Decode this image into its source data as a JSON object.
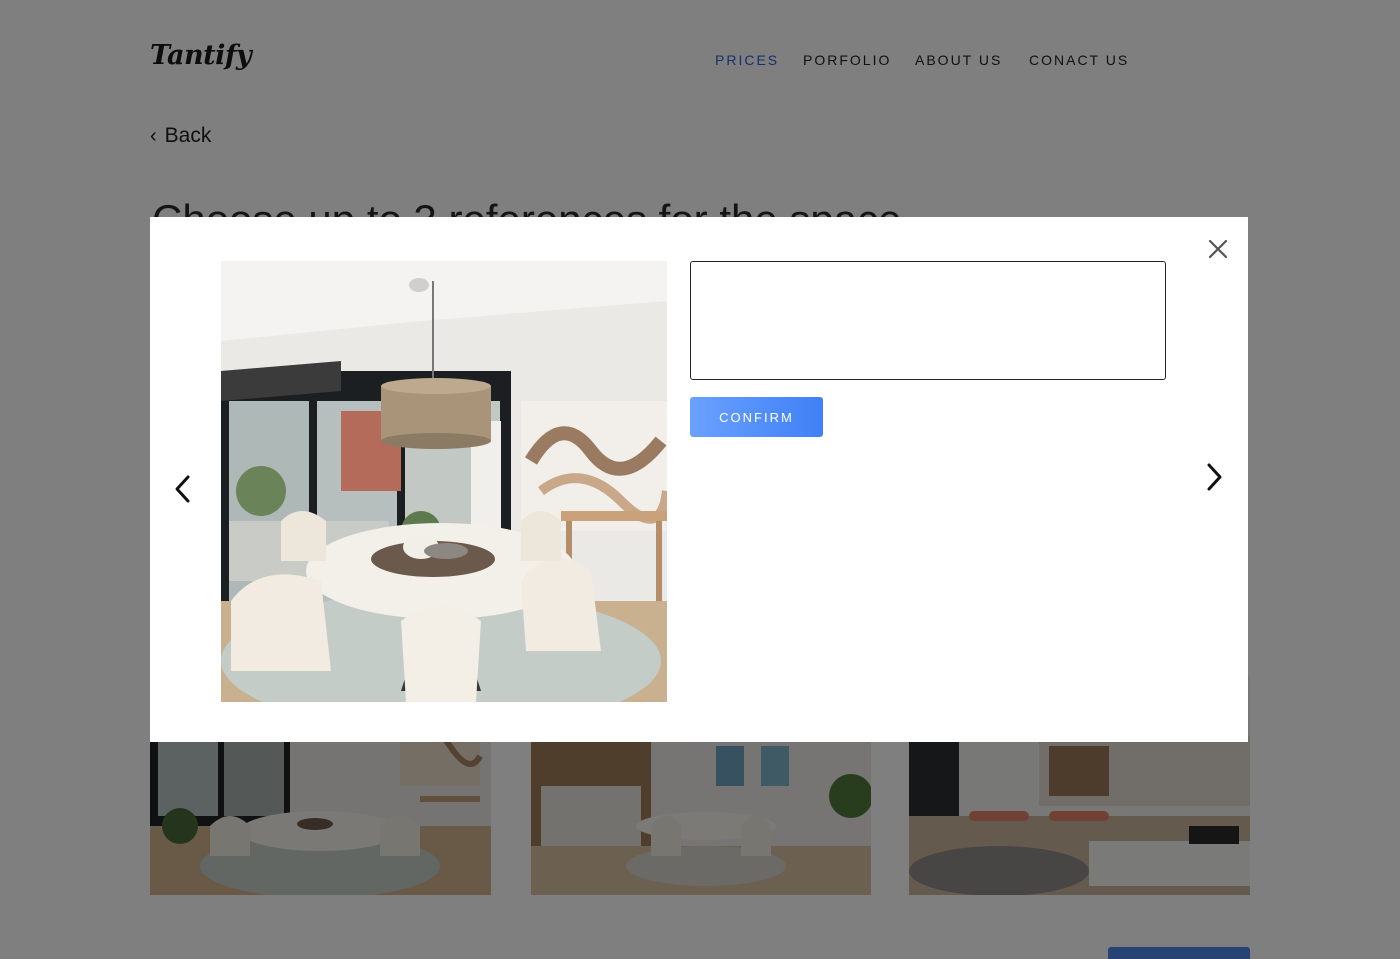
{
  "brand": {
    "logo_text": "Tantify"
  },
  "nav": {
    "items": [
      {
        "label": "PRICES",
        "active": true
      },
      {
        "label": "PORFOLIO",
        "active": false
      },
      {
        "label": "ABOUT US",
        "active": false
      },
      {
        "label": "CONACT US",
        "active": false
      }
    ]
  },
  "back": {
    "label": "Back"
  },
  "page_title": "Choose up to 3 references for the space",
  "gallery": {
    "thumbnails": [
      {
        "icon": "dining-room-photo"
      },
      {
        "icon": "kitchen-dining-photo"
      },
      {
        "icon": "living-room-photo"
      }
    ]
  },
  "modal": {
    "comment": {
      "value": "",
      "placeholder": ""
    },
    "confirm_label": "CONFIRM",
    "icons": {
      "close": "close-icon",
      "prev": "chevron-left-icon",
      "next": "chevron-right-icon"
    }
  },
  "colors": {
    "nav_active": "#2f63d6",
    "confirm_gradient_start": "#6aa1ff",
    "confirm_gradient_end": "#3f80f6",
    "overlay": "rgba(0,0,0,0.5)"
  }
}
